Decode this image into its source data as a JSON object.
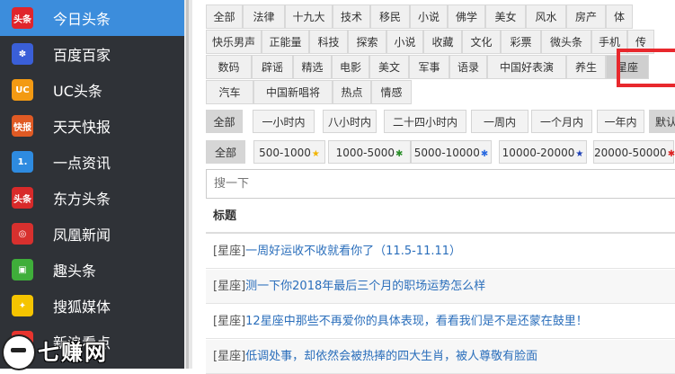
{
  "sidebar": {
    "items": [
      {
        "label": "今日头条",
        "icon": "toutiao-icon",
        "icon_text": "头条",
        "color": "#e0252c",
        "active": true
      },
      {
        "label": "百度百家",
        "icon": "baidu-paw-icon",
        "icon_text": "✽",
        "color": "#3a5fd8"
      },
      {
        "label": "UC头条",
        "icon": "uc-squirrel-icon",
        "icon_text": "UC",
        "color": "#f39a13"
      },
      {
        "label": "天天快报",
        "icon": "kuaibao-icon",
        "icon_text": "快报",
        "color": "#e05a24"
      },
      {
        "label": "一点资讯",
        "icon": "yidian-icon",
        "icon_text": "1.",
        "color": "#2e8be0"
      },
      {
        "label": "东方头条",
        "icon": "dongfang-icon",
        "icon_text": "头条",
        "color": "#d82a2a"
      },
      {
        "label": "凤凰新闻",
        "icon": "ifeng-icon",
        "icon_text": "◎",
        "color": "#d8302e"
      },
      {
        "label": "趣头条",
        "icon": "qutoutiao-icon",
        "icon_text": "▣",
        "color": "#3fae3a"
      },
      {
        "label": "搜狐媒体",
        "icon": "sohu-icon",
        "icon_text": "✦",
        "color": "#f5c400"
      },
      {
        "label": "新浪看点",
        "icon": "sina-icon",
        "icon_text": "◉",
        "color": "#e8342e"
      }
    ]
  },
  "watermark": {
    "text": "七赚网"
  },
  "categories": [
    [
      "全部",
      "法律",
      "十九大",
      "技术",
      "移民",
      "小说",
      "佛学",
      "美女",
      "风水",
      "房产",
      "体"
    ],
    [
      "快乐男声",
      "正能量",
      "科技",
      "探索",
      "小说",
      "收藏",
      "文化",
      "彩票",
      "微头条",
      "手机",
      "传"
    ],
    [
      "数码",
      "辟谣",
      "精选",
      "电影",
      "美文",
      "军事",
      "语录",
      "中国好表演",
      "养生",
      "星座"
    ],
    [
      "汽车",
      "中国新唱将",
      "热点",
      "情感"
    ]
  ],
  "time_filters": [
    "全部",
    "一小时内",
    "八小时内",
    "二十四小时内",
    "一周内",
    "一个月内",
    "一年内",
    "默认"
  ],
  "read_filters": [
    {
      "label": "全部",
      "star": "",
      "star_color": ""
    },
    {
      "label": "500-1000",
      "star": "★",
      "star_color": "#f2b400"
    },
    {
      "label": "1000-5000",
      "star": "✱",
      "star_color": "#2a8f2a"
    },
    {
      "label": "5000-10000",
      "star": "✱",
      "star_color": "#2a6ae0"
    },
    {
      "label": "10000-20000",
      "star": "★",
      "star_color": "#1c3fb5"
    },
    {
      "label": "20000-50000",
      "star": "✱",
      "star_color": "#d22"
    }
  ],
  "search": {
    "placeholder": "搜一下"
  },
  "table": {
    "header": "标题",
    "rows": [
      {
        "cat": "[星座]",
        "title": "一周好运收不收就看你了（11.5-11.11）"
      },
      {
        "cat": "[星座]",
        "title": "测一下你2018年最后三个月的职场运势怎么样"
      },
      {
        "cat": "[星座]",
        "title": "12星座中那些不再爱你的具体表现，看看我们是不是还蒙在鼓里！"
      },
      {
        "cat": "[星座]",
        "title": "低调处事，却依然会被热捧的四大生肖，被人尊敬有脸面"
      }
    ]
  }
}
